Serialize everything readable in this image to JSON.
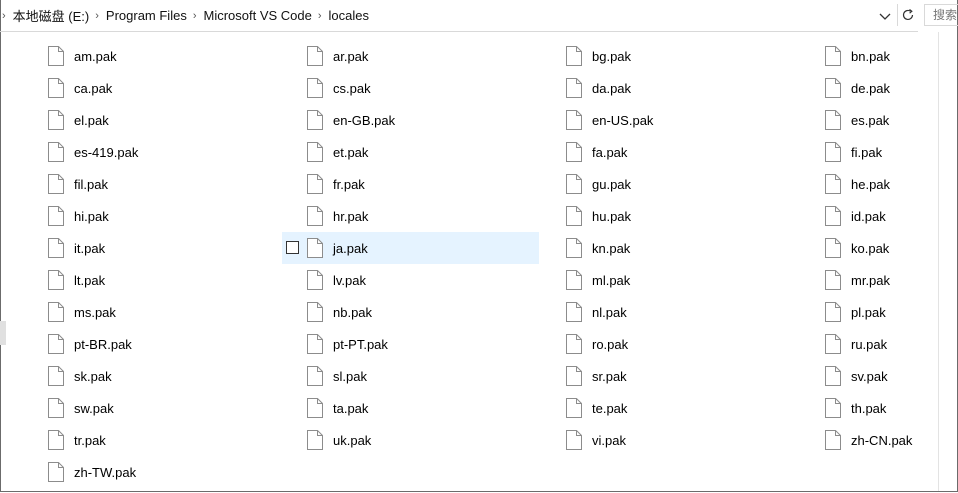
{
  "breadcrumb": [
    "本地磁盘 (E:)",
    "Program Files",
    "Microsoft VS Code",
    "locales"
  ],
  "search": {
    "placeholder": "搜索"
  },
  "files": [
    "am.pak",
    "ar.pak",
    "bg.pak",
    "bn.pak",
    "ca.pak",
    "cs.pak",
    "da.pak",
    "de.pak",
    "el.pak",
    "en-GB.pak",
    "en-US.pak",
    "es.pak",
    "es-419.pak",
    "et.pak",
    "fa.pak",
    "fi.pak",
    "fil.pak",
    "fr.pak",
    "gu.pak",
    "he.pak",
    "hi.pak",
    "hr.pak",
    "hu.pak",
    "id.pak",
    "it.pak",
    "ja.pak",
    "kn.pak",
    "ko.pak",
    "lt.pak",
    "lv.pak",
    "ml.pak",
    "mr.pak",
    "ms.pak",
    "nb.pak",
    "nl.pak",
    "pl.pak",
    "pt-BR.pak",
    "pt-PT.pak",
    "ro.pak",
    "ru.pak",
    "sk.pak",
    "sl.pak",
    "sr.pak",
    "sv.pak",
    "sw.pak",
    "ta.pak",
    "te.pak",
    "th.pak",
    "tr.pak",
    "uk.pak",
    "vi.pak",
    "zh-CN.pak",
    "zh-TW.pak"
  ],
  "hovered_file": "ja.pak",
  "colors": {
    "hover": "#e5f3ff",
    "separator": "#d9d9d9"
  },
  "icons": {
    "file": "file-icon",
    "separator": "chevron-right-icon",
    "dropdown": "chevron-down-icon",
    "refresh": "refresh-icon"
  }
}
